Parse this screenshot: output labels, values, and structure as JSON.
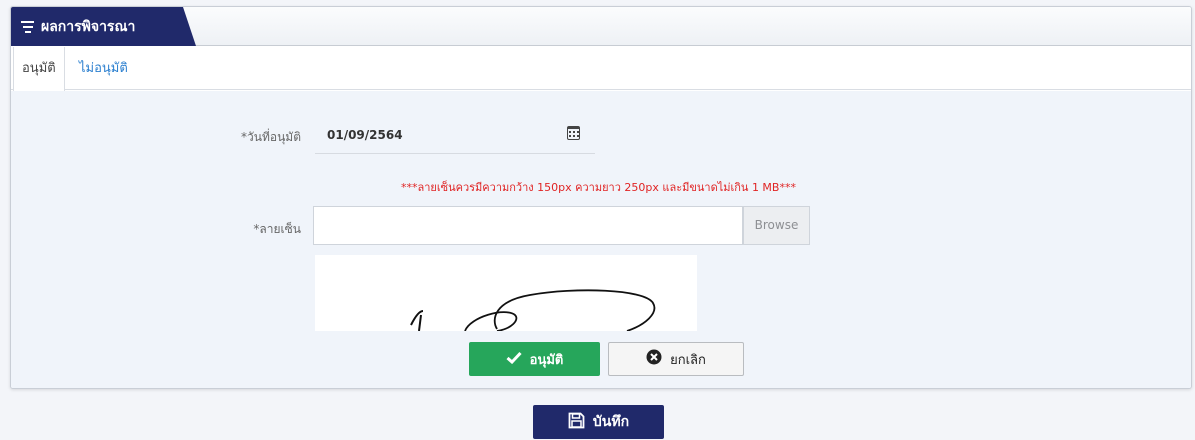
{
  "header": {
    "title": "ผลการพิจารณา",
    "icon": "filter-list-icon"
  },
  "tabs": [
    {
      "label": "อนุมัติ",
      "active": true
    },
    {
      "label": "ไม่อนุมัติ",
      "active": false
    }
  ],
  "form": {
    "approve_date_label": "*วันที่อนุมัติ",
    "approve_date_value": "01/09/2564",
    "signature_note": "***ลายเซ็นควรมีความกว้าง 150px ความยาว 250px และมีขนาดไม่เกิน 1 MB***",
    "signature_label": "*ลายเซ็น",
    "file_value": "",
    "browse_label": "Browse"
  },
  "actions": {
    "approve_label": "อนุมัติ",
    "cancel_label": "ยกเลิก",
    "save_label": "บันทึก"
  },
  "colors": {
    "header_tab": "#20296a",
    "approve_button": "#26a65b",
    "warning_text": "#e02424",
    "active_link": "#2b7fcf"
  }
}
